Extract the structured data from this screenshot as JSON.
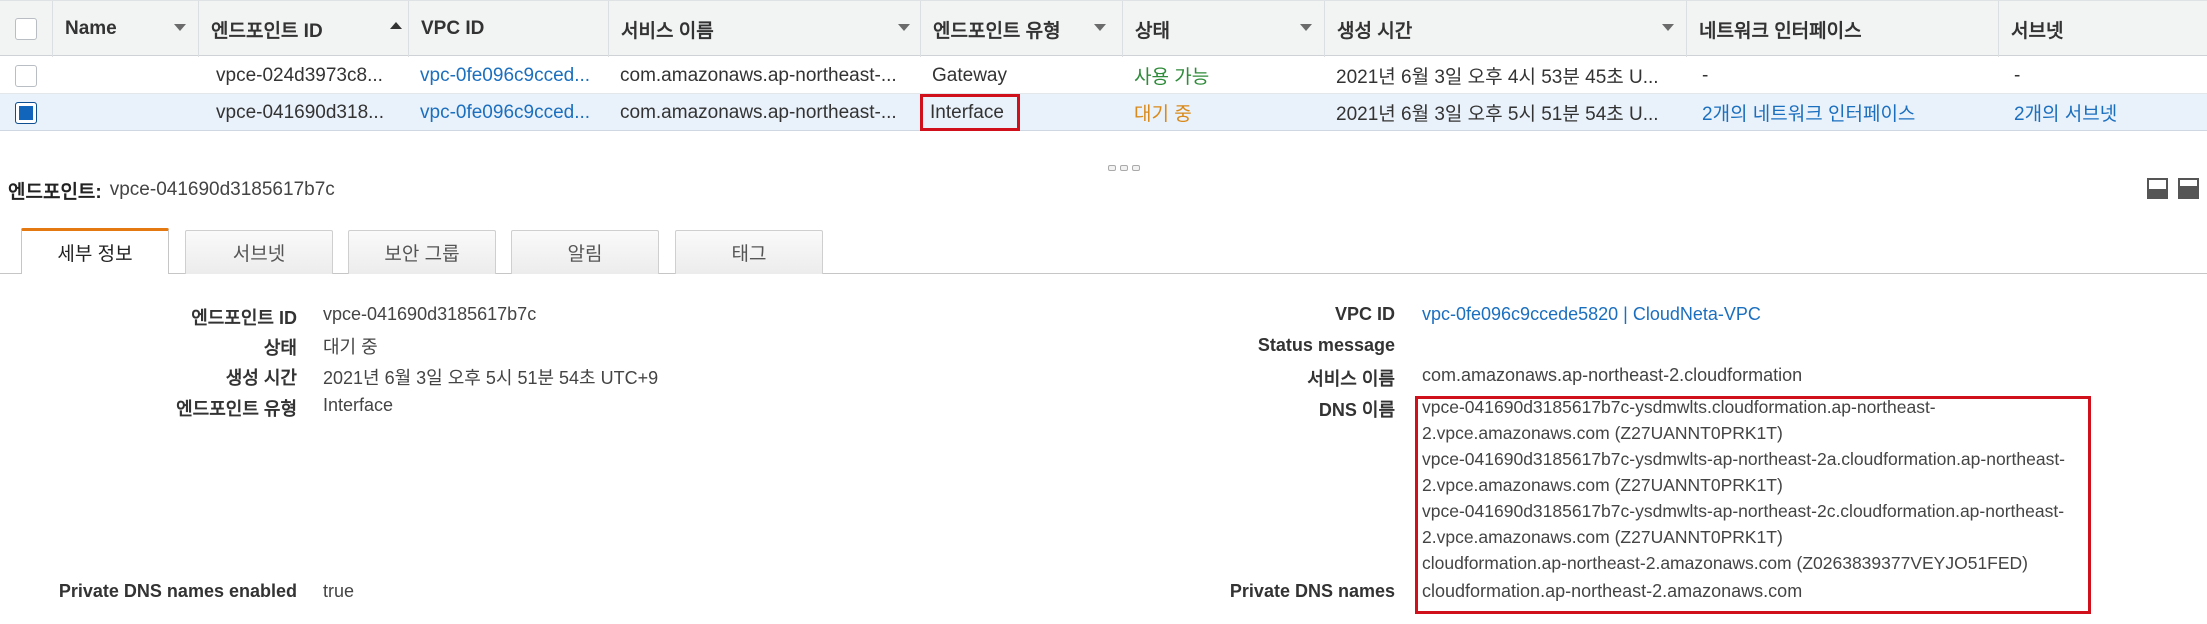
{
  "table": {
    "headers": {
      "name": "Name",
      "endpoint_id": "엔드포인트 ID",
      "vpc_id": "VPC ID",
      "service_name": "서비스 이름",
      "endpoint_type": "엔드포인트 유형",
      "status": "상태",
      "created": "생성 시간",
      "network_interfaces": "네트워크 인터페이스",
      "subnets": "서브넷"
    },
    "rows": [
      {
        "name": "",
        "endpoint_id": "vpce-024d3973c8...",
        "vpc_id": "vpc-0fe096c9cced...",
        "service_name": "com.amazonaws.ap-northeast-...",
        "endpoint_type": "Gateway",
        "status": "사용 가능",
        "created": "2021년 6월 3일 오후 4시 53분 45초 U...",
        "network_interfaces": "-",
        "subnets": "-"
      },
      {
        "name": "",
        "endpoint_id": "vpce-041690d318...",
        "vpc_id": "vpc-0fe096c9cced...",
        "service_name": "com.amazonaws.ap-northeast-...",
        "endpoint_type": "Interface",
        "status": "대기 중",
        "created": "2021년 6월 3일 오후 5시 51분 54초 U...",
        "network_interfaces": "2개의 네트워크 인터페이스",
        "subnets": "2개의 서브넷"
      }
    ]
  },
  "detail": {
    "title_label": "엔드포인트:",
    "title_value": "vpce-041690d3185617b7c",
    "tabs": [
      "세부 정보",
      "서브넷",
      "보안 그룹",
      "알림",
      "태그"
    ],
    "left": {
      "endpoint_id_label": "엔드포인트 ID",
      "endpoint_id": "vpce-041690d3185617b7c",
      "status_label": "상태",
      "status": "대기 중",
      "created_label": "생성 시간",
      "created": "2021년 6월 3일 오후 5시 51분 54초 UTC+9",
      "type_label": "엔드포인트 유형",
      "type": "Interface",
      "private_dns_enabled_label": "Private DNS names enabled",
      "private_dns_enabled": "true"
    },
    "right": {
      "vpc_id_label": "VPC ID",
      "vpc_id": "vpc-0fe096c9ccede5820 | CloudNeta-VPC",
      "status_message_label": "Status message",
      "service_name_label": "서비스 이름",
      "service_name": "com.amazonaws.ap-northeast-2.cloudformation",
      "dns_names_label": "DNS 이름",
      "dns_lines": [
        "vpce-041690d3185617b7c-ysdmwlts.cloudformation.ap-northeast-",
        "2.vpce.amazonaws.com (Z27UANNT0PRK1T)",
        "vpce-041690d3185617b7c-ysdmwlts-ap-northeast-2a.cloudformation.ap-northeast-",
        "2.vpce.amazonaws.com (Z27UANNT0PRK1T)",
        "vpce-041690d3185617b7c-ysdmwlts-ap-northeast-2c.cloudformation.ap-northeast-",
        "2.vpce.amazonaws.com (Z27UANNT0PRK1T)",
        "cloudformation.ap-northeast-2.amazonaws.com (Z0263839377VEYJO51FED)"
      ],
      "private_dns_names_label": "Private DNS names",
      "private_dns_names": "cloudformation.ap-northeast-2.amazonaws.com"
    }
  },
  "colors": {
    "link": "#1b6fbf",
    "status_available": "#2e8b3a",
    "status_pending": "#d98a1a",
    "highlight_box": "#d0111c",
    "active_tab_accent": "#e47911",
    "selected_row": "#e9f1fa"
  }
}
